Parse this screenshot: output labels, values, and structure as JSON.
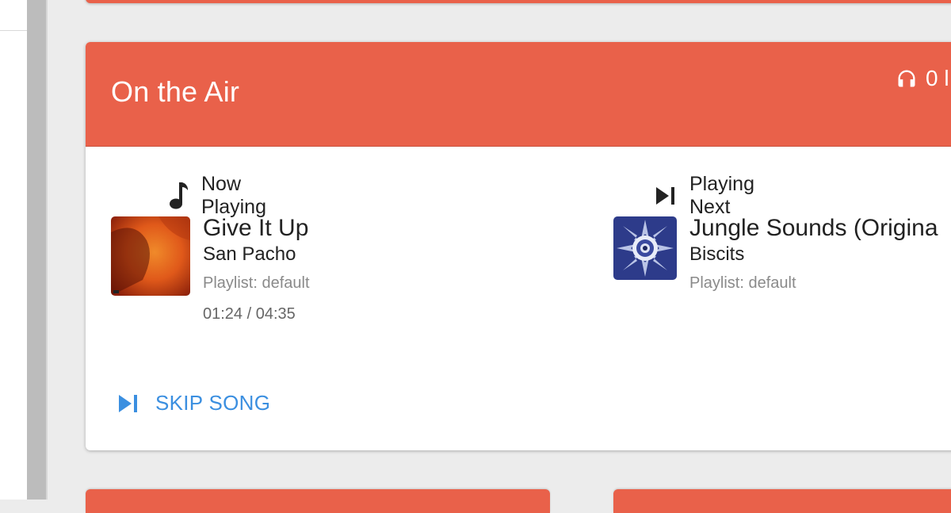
{
  "card": {
    "title": "On the Air",
    "listener_count": "0 l",
    "skip_label": "SKIP SONG"
  },
  "now_playing": {
    "label": "Now Playing",
    "title": "Give It Up",
    "artist": "San Pacho",
    "playlist": "Playlist: default",
    "time": "01:24 / 04:35"
  },
  "playing_next": {
    "label": "Playing Next",
    "title": "Jungle Sounds (Origina",
    "artist": "Biscits",
    "playlist": "Playlist: default"
  },
  "icons": {
    "listeners": "headphones-icon",
    "now_playing": "music-note-icon",
    "playing_next": "skip-next-icon",
    "skip": "skip-next-icon"
  },
  "colors": {
    "header": "#e9614a",
    "accent_blue": "#3b8fe0",
    "background": "#ececec"
  }
}
